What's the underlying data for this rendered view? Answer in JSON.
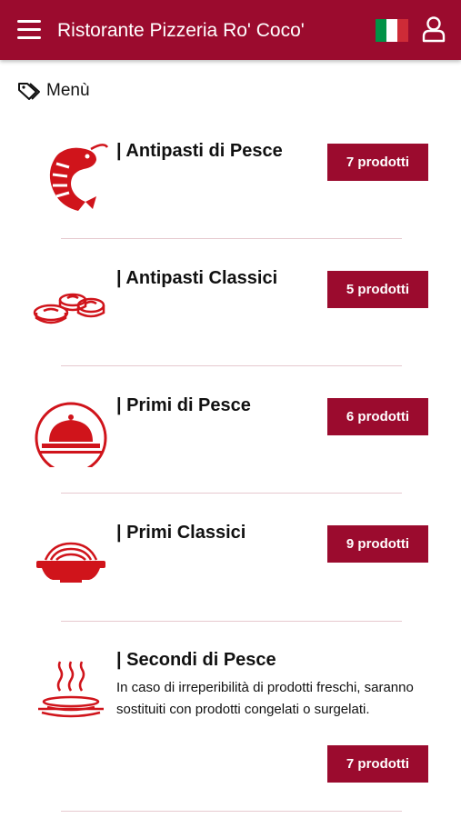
{
  "header": {
    "title": "Ristorante Pizzeria Ro' Coco'",
    "flag_colors": [
      "#009246",
      "#ffffff",
      "#ce2b37"
    ],
    "menu_icon": "hamburger-icon",
    "language_icon": "italian-flag-icon",
    "account_icon": "user-icon"
  },
  "breadcrumb": {
    "icon": "tags-icon",
    "label": "Menù"
  },
  "colors": {
    "brand": "#9b0b2e",
    "icon_red": "#d0141b"
  },
  "categories": [
    {
      "title": "| Antipasti di Pesce",
      "button": "7 prodotti",
      "icon": "shrimp-icon"
    },
    {
      "title": "| Antipasti Classici",
      "button": "5 prodotti",
      "icon": "appetizer-plate-icon"
    },
    {
      "title": "| Primi di Pesce",
      "button": "6 prodotti",
      "icon": "cloche-icon"
    },
    {
      "title": "| Primi Classici",
      "button": "9 prodotti",
      "icon": "pasta-bowl-icon"
    },
    {
      "title": "| Secondi di Pesce",
      "button": "7 prodotti",
      "icon": "hot-dish-icon",
      "description": "In caso di irreperibilità di prodotti freschi, saranno sostituiti con prodotti congelati o surgelati."
    }
  ]
}
